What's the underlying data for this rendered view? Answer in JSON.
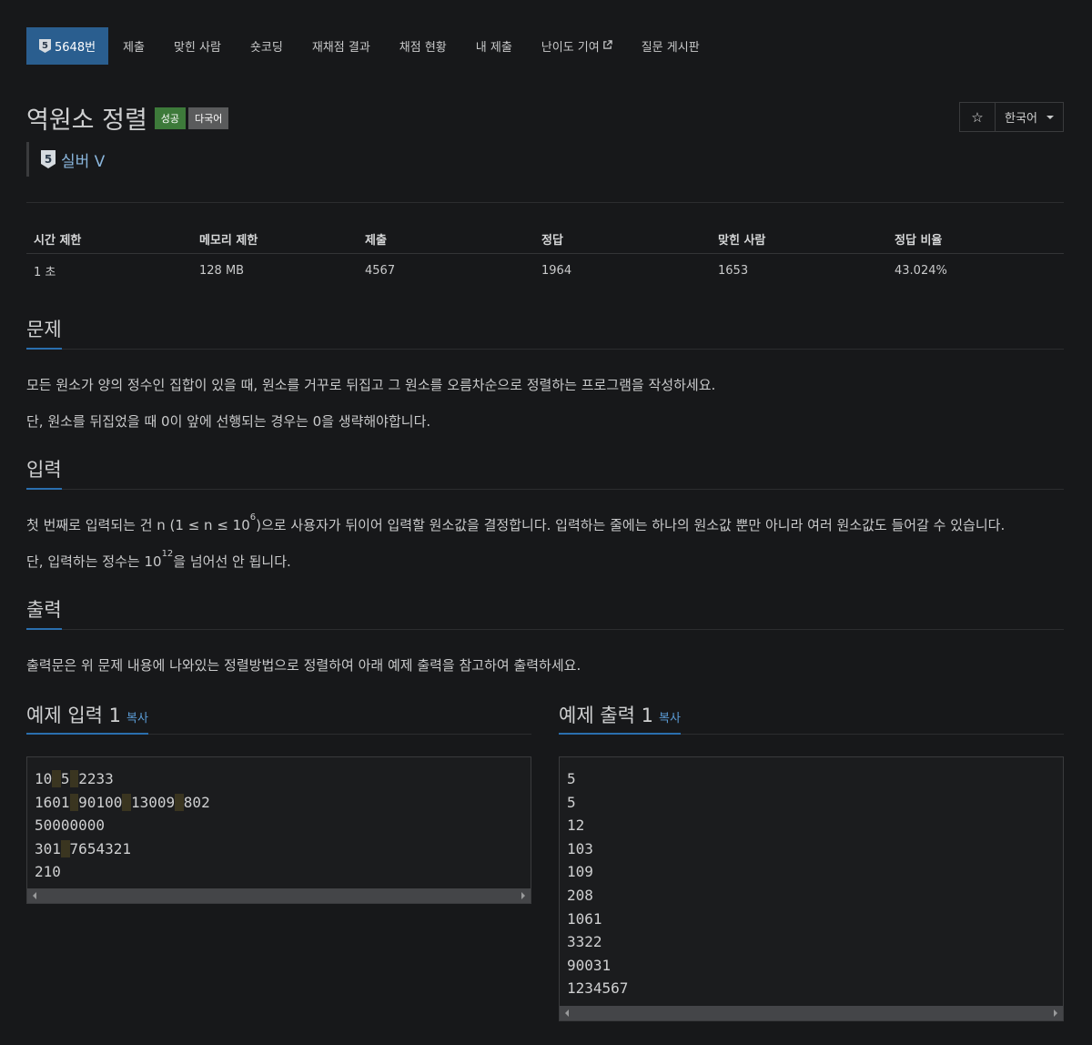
{
  "nav": {
    "problem_tier_glyph": "5",
    "items": [
      "5648번",
      "제출",
      "맞힌 사람",
      "숏코딩",
      "재채점 결과",
      "채점 현황",
      "내 제출",
      "난이도 기여",
      "질문 게시판"
    ]
  },
  "header": {
    "title": "역원소 정렬",
    "badge_success": "성공",
    "badge_lang": "다국어",
    "lang_button": "한국어",
    "star_icon": "star-icon"
  },
  "tier": {
    "glyph": "5",
    "text": "실버 V"
  },
  "info": {
    "headers": [
      "시간 제한",
      "메모리 제한",
      "제출",
      "정답",
      "맞힌 사람",
      "정답 비율"
    ],
    "values": [
      "1 초",
      "128 MB",
      "4567",
      "1964",
      "1653",
      "43.024%"
    ]
  },
  "sections": {
    "problem_title": "문제",
    "problem_p1": "모든 원소가 양의 정수인 집합이 있을 때, 원소를 거꾸로 뒤집고 그 원소를 오름차순으로 정렬하는 프로그램을 작성하세요.",
    "problem_p2": "단, 원소를 뒤집었을 때 0이 앞에 선행되는 경우는 0을 생략해야합니다.",
    "input_title": "입력",
    "input_p1_a": "첫 번째로 입력되는 건 n (1 ≤ n ≤ 10",
    "input_p1_sup": "6",
    "input_p1_b": ")으로 사용자가 뒤이어 입력할 원소값을 결정합니다. 입력하는 줄에는 하나의 원소값 뿐만 아니라 여러 원소값도 들어갈 수 있습니다.",
    "input_p2_a": "단, 입력하는 정수는 10",
    "input_p2_sup": "12",
    "input_p2_b": "을 넘어선 안 됩니다.",
    "output_title": "출력",
    "output_p1": "출력문은 위 문제 내용에 나와있는 정렬방법으로 정렬하여 아래 예제 출력을 참고하여 출력하세요."
  },
  "samples": {
    "input_title": "예제 입력 1",
    "output_title": "예제 출력 1",
    "copy_label": "복사",
    "input_lines": [
      [
        "10",
        "5",
        "2233"
      ],
      [
        "1601",
        "90100",
        "13009",
        "802"
      ],
      [
        "50000000"
      ],
      [
        "301",
        "7654321"
      ],
      [
        "210"
      ]
    ],
    "output_lines": [
      "5",
      "5",
      "12",
      "103",
      "109",
      "208",
      "1061",
      "3322",
      "90031",
      "1234567"
    ]
  },
  "colors": {
    "background": "#17181a",
    "accent": "#2a5e8f",
    "success": "#3d7a3a",
    "tier_text": "#8ab6dd",
    "link": "#5b9bd5"
  }
}
